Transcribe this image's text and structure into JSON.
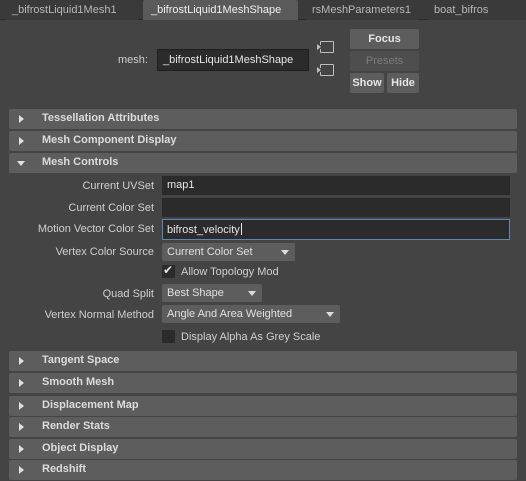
{
  "tabs": [
    {
      "label": "_bifrostLiquid1Mesh1",
      "active": false
    },
    {
      "label": "_bifrostLiquid1MeshShape",
      "active": true
    },
    {
      "label": "rsMeshParameters1",
      "active": false
    },
    {
      "label": "boat_bifros",
      "active": false
    }
  ],
  "header": {
    "mesh_label": "mesh:",
    "mesh_value": "_bifrostLiquid1MeshShape",
    "focus_label": "Focus",
    "presets_label": "Presets",
    "show_label": "Show",
    "hide_label": "Hide"
  },
  "sections": {
    "tessellation": "Tessellation Attributes",
    "component_display": "Mesh Component Display",
    "mesh_controls": "Mesh Controls",
    "tangent_space": "Tangent Space",
    "smooth_mesh": "Smooth Mesh",
    "displacement_map": "Displacement Map",
    "render_stats": "Render Stats",
    "object_display": "Object Display",
    "redshift": "Redshift"
  },
  "mesh_controls": {
    "current_uvset_label": "Current UVSet",
    "current_uvset_value": "map1",
    "current_colorset_label": "Current Color Set",
    "current_colorset_value": "",
    "motion_vector_label": "Motion Vector Color Set",
    "motion_vector_value": "bifrost_velocity",
    "vertex_color_source_label": "Vertex Color Source",
    "vertex_color_source_value": "Current Color Set",
    "allow_topology_label": "Allow Topology Mod",
    "allow_topology_checked": true,
    "quad_split_label": "Quad Split",
    "quad_split_value": "Best Shape",
    "vertex_normal_label": "Vertex Normal Method",
    "vertex_normal_value": "Angle And Area Weighted",
    "display_alpha_label": "Display Alpha As Grey Scale",
    "display_alpha_checked": false
  }
}
